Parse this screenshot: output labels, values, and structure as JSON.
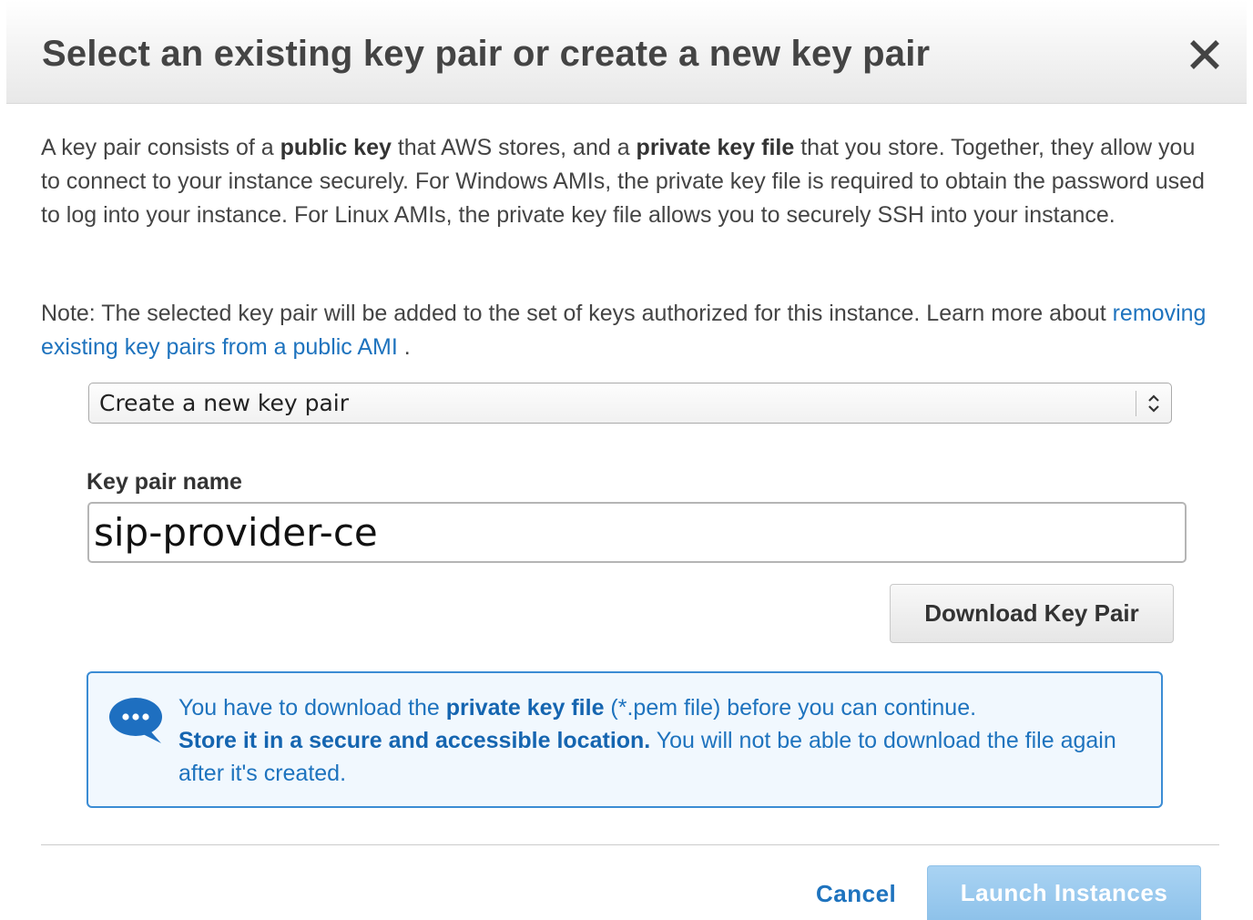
{
  "dialog": {
    "title": "Select an existing key pair or create a new key pair",
    "close_icon": "close-icon"
  },
  "intro": {
    "t1": "A key pair consists of a ",
    "b1": "public key",
    "t2": " that AWS stores, and a ",
    "b2": "private key file",
    "t3": " that you store. Together, they allow you to connect to your instance securely. For Windows AMIs, the private key file is required to obtain the password used to log into your instance. For Linux AMIs, the private key file allows you to securely SSH into your instance."
  },
  "note": {
    "text": "Note: The selected key pair will be added to the set of keys authorized for this instance. Learn more about ",
    "link": "removing existing key pairs from a public AMI",
    "end": " ."
  },
  "key_pair_select": {
    "selected": "Create a new key pair",
    "arrows_icon": "select-arrows-icon"
  },
  "key_pair_name": {
    "label": "Key pair name",
    "value": "sip-provider-ce"
  },
  "download_button": {
    "label": "Download Key Pair"
  },
  "info_box": {
    "icon": "chat-bubble-icon",
    "t1": "You have to download the ",
    "b1": "private key file",
    "t2": " (*.pem file) before you can continue.",
    "b2": "Store it in a secure and accessible location.",
    "t3": " You will not be able to download the file again after it's created.",
    "color": "#1e73be",
    "border_color": "#3b8cd4",
    "background": "#f1f8fe"
  },
  "footer": {
    "cancel_label": "Cancel",
    "launch_label": "Launch Instances",
    "launch_color": "#9ccbee"
  }
}
